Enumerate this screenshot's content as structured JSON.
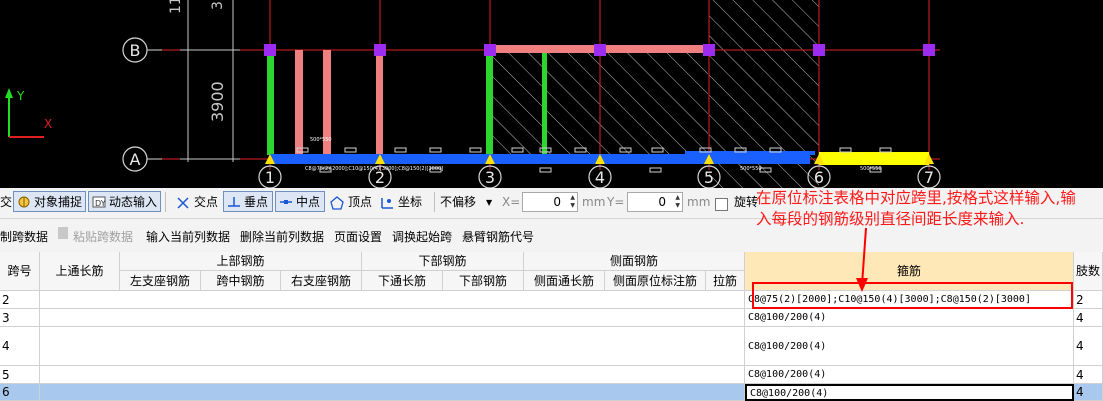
{
  "cad": {
    "axis_rows": [
      "B",
      "A"
    ],
    "axis_cols": [
      "1",
      "2",
      "3",
      "4",
      "5",
      "6",
      "7"
    ],
    "dim_3900": "3900",
    "dim_top_left": "11",
    "dim_top_small": "3",
    "ucs_y": "Y",
    "ucs_x": "X",
    "beam_note_1": "C8@75(2)[2000];C10@150(4)[3000];C8@150(2)[3000]",
    "beam_note_2": "500*550",
    "beam_note_3": "500*550",
    "beam_note_4": "500*550"
  },
  "toolbar": {
    "partial_left": "交",
    "snap": "对象捕捉",
    "dynamic_input": "动态输入",
    "intersection": "交点",
    "perpendicular": "垂点",
    "midpoint": "中点",
    "vertex": "顶点",
    "coordinate": "坐标",
    "offset_mode": "不偏移",
    "x_label": "X=",
    "x_value": "0",
    "mm1": "mm",
    "y_label": "Y=",
    "y_value": "0",
    "mm2": "mm",
    "rotate": "旋转"
  },
  "toolbar2": {
    "copy_span": "制跨数据",
    "paste_span": "粘贴跨数据",
    "input_column": "输入当前列数据",
    "delete_column": "删除当前列数据",
    "page_setup": "页面设置",
    "switch_start": "调换起始跨",
    "cantilever": "悬臂钢筋代号"
  },
  "annotation": "在原位标注表格中对应跨里,按格式这样输入,输入每段的钢筋级别直径间距长度来输入.",
  "table": {
    "headers": {
      "span": "跨号",
      "top_through": "上通长筋",
      "upper_group": "上部钢筋",
      "left_support": "左支座钢筋",
      "mid_span": "跨中钢筋",
      "right_support": "右支座钢筋",
      "lower_group": "下部钢筋",
      "bottom_through": "下通长筋",
      "bottom_rebar": "下部钢筋",
      "side_group": "侧面钢筋",
      "side_through": "侧面通长筋",
      "side_original": "侧面原位标注筋",
      "tie": "拉筋",
      "stirrup": "箍筋",
      "legs": "肢数"
    },
    "rows": [
      {
        "span": "2",
        "stirrup": "C8@75(2)[2000];C10@150(4)[3000];C8@150(2)[3000]",
        "legs": "2"
      },
      {
        "span": "3",
        "stirrup": "C8@100/200(4)",
        "legs": "4"
      },
      {
        "span": "4",
        "stirrup": "C8@100/200(4)",
        "legs": "4"
      },
      {
        "span": "5",
        "stirrup": "C8@100/200(4)",
        "legs": "4"
      },
      {
        "span": "6",
        "stirrup": "C8@100/200(4)",
        "legs": "4"
      }
    ]
  }
}
